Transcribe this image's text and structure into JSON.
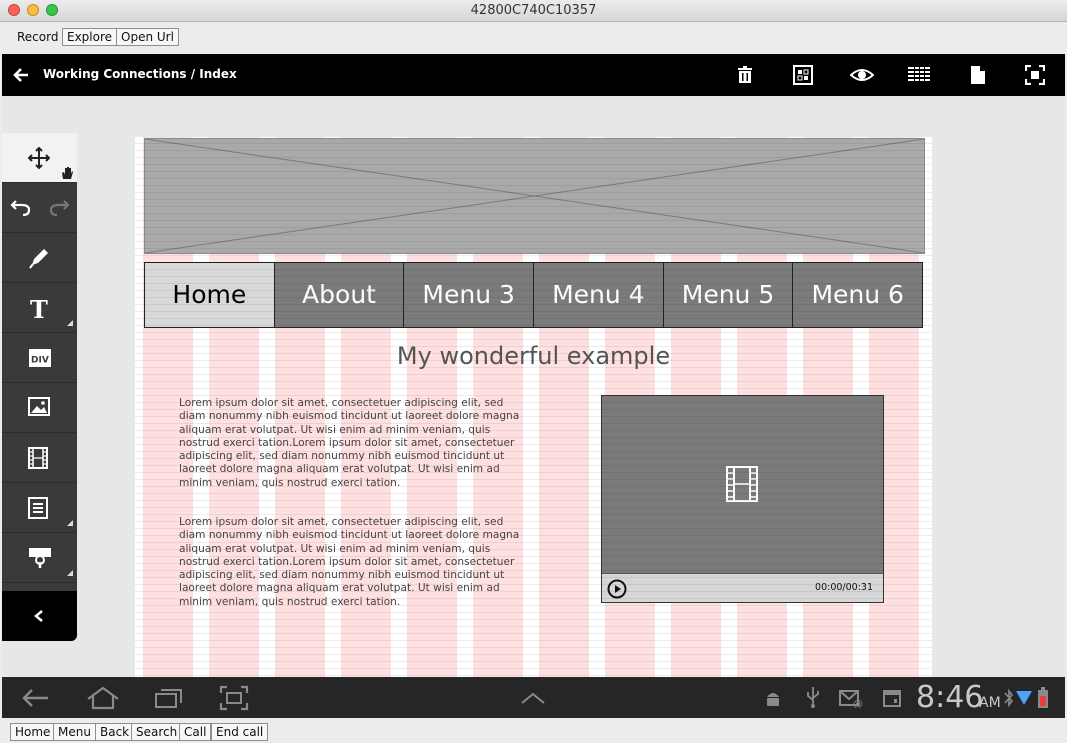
{
  "window": {
    "title": "42800C740C10357"
  },
  "toolbar": {
    "record": "Record",
    "explore": "Explore",
    "open_url": "Open Url"
  },
  "app_header": {
    "breadcrumb": "Working Connections / Index",
    "icons": [
      "back-arrow-icon",
      "trash-icon",
      "grid-view-icon",
      "eye-icon",
      "list-view-icon",
      "document-icon",
      "fullscreen-icon"
    ]
  },
  "palette": {
    "tools": [
      "move-icon",
      "undo-icon",
      "redo-icon",
      "pen-icon",
      "text-tool-icon",
      "div-tool-icon",
      "image-tool-icon",
      "video-tool-icon",
      "form-tool-icon",
      "widget-tool-icon",
      "collapse-chevron-icon"
    ],
    "text_tool_label": "T",
    "div_tool_label": "DIV"
  },
  "page": {
    "nav": [
      "Home",
      "About",
      "Menu 3",
      "Menu 4",
      "Menu 5",
      "Menu 6"
    ],
    "heading": "My wonderful example",
    "paragraph1": "Lorem ipsum dolor sit amet, consectetuer adipiscing elit, sed diam nonummy nibh euismod tincidunt ut laoreet dolore magna aliquam erat volutpat. Ut wisi enim ad minim veniam, quis nostrud exerci tation.Lorem ipsum dolor sit amet, consectetuer adipiscing elit, sed diam nonummy nibh euismod tincidunt ut laoreet dolore magna aliquam erat volutpat. Ut wisi enim ad minim veniam, quis nostrud exerci tation.",
    "paragraph2": "Lorem ipsum dolor sit amet, consectetuer adipiscing elit, sed diam nonummy nibh euismod tincidunt ut laoreet dolore magna aliquam erat volutpat. Ut wisi enim ad minim veniam, quis nostrud exerci tation.Lorem ipsum dolor sit amet, consectetuer adipiscing elit, sed diam nonummy nibh euismod tincidunt ut laoreet dolore magna aliquam erat volutpat. Ut wisi enim ad minim veniam, quis nostrud exerci tation.",
    "video_time": "00:00/00:31"
  },
  "android": {
    "time": "8:46",
    "ampm": "AM"
  },
  "bottom_buttons": {
    "home": "Home",
    "menu": "Menu",
    "back": "Back",
    "search": "Search",
    "call": "Call",
    "end_call": "End call"
  },
  "colors": {
    "header_bg": "#000000",
    "nav_active": "#d8d8d8",
    "nav_inactive": "#7b7b7b",
    "grid_column": "#ffe0e0"
  }
}
